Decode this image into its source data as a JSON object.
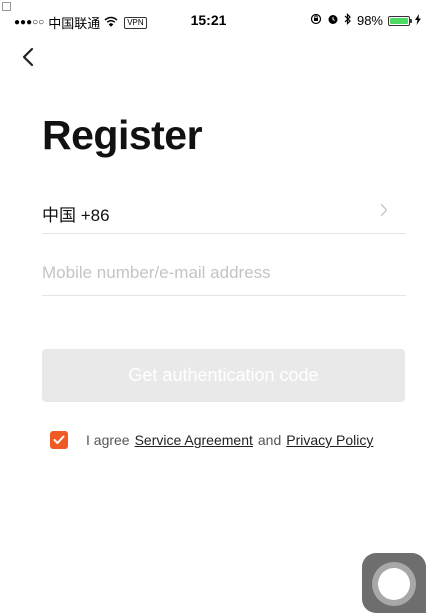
{
  "status_bar": {
    "carrier": "中国联通",
    "vpn_label": "VPN",
    "time": "15:21",
    "battery_percent": "98%",
    "battery_level": 0.98,
    "signal_icon": "signal-dots-icon",
    "wifi_icon": "wifi-icon",
    "lock_icon": "orientation-lock-icon",
    "alarm_icon": "alarm-icon",
    "bluetooth_icon": "bluetooth-icon",
    "charging_icon": "charging-bolt-icon"
  },
  "nav": {
    "back_icon": "chevron-left-icon"
  },
  "title": "Register",
  "country": {
    "label": "中国 +86",
    "chevron_icon": "chevron-right-icon"
  },
  "account_input": {
    "value": "",
    "placeholder": "Mobile number/e-mail address"
  },
  "get_code_button": {
    "label": "Get authentication code"
  },
  "agreement": {
    "checked": true,
    "prefix": "I agree",
    "service_link": "Service Agreement",
    "and": "and",
    "privacy_link": "Privacy Policy"
  },
  "colors": {
    "accent": "#f05a24",
    "button_disabled_bg": "#e9e9e9",
    "battery_green": "#4cd964",
    "placeholder": "#c4c4c4"
  }
}
